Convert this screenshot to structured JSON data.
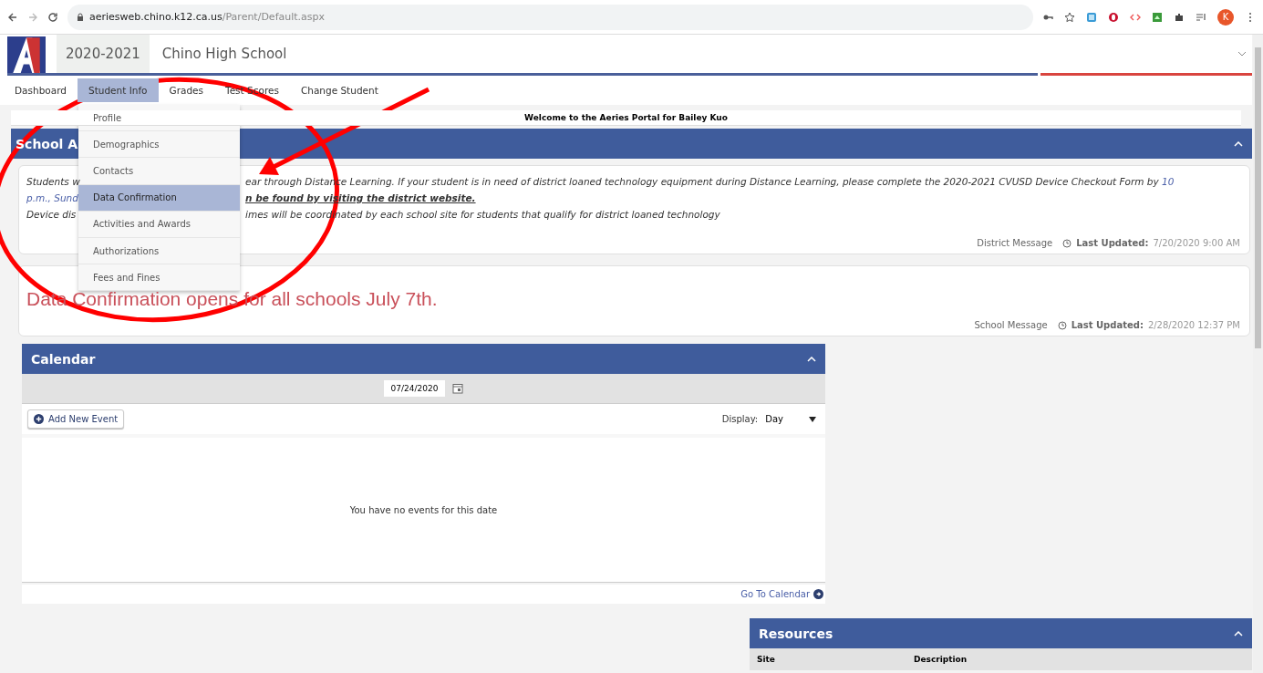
{
  "browser": {
    "url_host": "aeriesweb.chino.k12.ca.us",
    "url_path": "/Parent/Default.aspx",
    "profile_initial": "K"
  },
  "header": {
    "year": "2020-2021",
    "school": "Chino High School"
  },
  "nav": [
    {
      "label": "Dashboard",
      "selected": false
    },
    {
      "label": "Student Info",
      "selected": true
    },
    {
      "label": "Grades",
      "selected": false
    },
    {
      "label": "Test Scores",
      "selected": false
    },
    {
      "label": "Change Student",
      "selected": false
    }
  ],
  "dropdown": [
    {
      "label": "Profile",
      "selected": false
    },
    {
      "label": "Demographics",
      "selected": false
    },
    {
      "label": "Contacts",
      "selected": false
    },
    {
      "label": "Data Confirmation",
      "selected": true
    },
    {
      "label": "Activities and Awards",
      "selected": false
    },
    {
      "label": "Authorizations",
      "selected": false
    },
    {
      "label": "Fees and Fines",
      "selected": false
    }
  ],
  "welcome": "Welcome to the Aeries Portal for Bailey Kuo",
  "announcements": {
    "title": "School A",
    "lines": [
      {
        "left": [
          {
            "kind": "plain",
            "text": "Students w"
          }
        ],
        "right": [
          {
            "kind": "plain",
            "text": "ear through Distance Learning. If your student is in need of district loaned technology equipment during Distance Learning, please complete the 2020-2021 CVUSD Device Checkout Form by "
          },
          {
            "kind": "link",
            "text": "10"
          }
        ]
      },
      {
        "left": [
          {
            "kind": "link",
            "text": "p.m., Sund"
          }
        ],
        "right": [
          {
            "kind": "bold",
            "text": "n be found by visiting the district website."
          }
        ]
      },
      {
        "left": [
          {
            "kind": "plain",
            "text": "Device dis"
          }
        ],
        "right": [
          {
            "kind": "plain",
            "text": "imes will be coordinated by each school site for students that qualify for district loaned technology"
          }
        ]
      }
    ],
    "source": "District Message",
    "updated_label": "Last Updated:",
    "updated_value": "7/20/2020 9:00 AM"
  },
  "school_message": {
    "text": "Data Confirmation opens for all schools July 7th.",
    "source": "School Message",
    "updated_label": "Last Updated:",
    "updated_value": "2/28/2020 12:37 PM"
  },
  "calendar": {
    "title": "Calendar",
    "date": "07/24/2020",
    "add_button": "Add New Event",
    "display_label": "Display:",
    "display_value": "Day",
    "empty_text": "You have no events for this date",
    "go_link": "Go To Calendar"
  },
  "resources": {
    "title": "Resources",
    "columns": [
      "Site",
      "Description"
    ]
  }
}
